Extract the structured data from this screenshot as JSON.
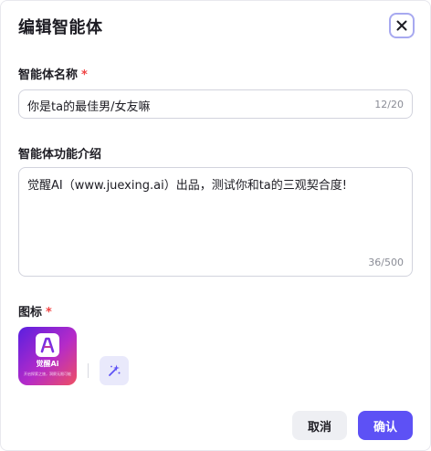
{
  "dialog": {
    "title": "编辑智能体",
    "close_icon": "close-icon"
  },
  "name_field": {
    "label": "智能体名称",
    "required_mark": "*",
    "value": "你是ta的最佳男/女友嘛",
    "counter": "12/20"
  },
  "description_field": {
    "label": "智能体功能介绍",
    "value": "觉醒AI（www.juexing.ai）出品，测试你和ta的三观契合度!",
    "counter": "36/500"
  },
  "icon_field": {
    "label": "图标",
    "required_mark": "*",
    "logo_text": "觉醒Ai",
    "logo_tagline": "开启探索之旅，洞察无限可能",
    "generate_icon": "sparkle-icon"
  },
  "footer": {
    "cancel_label": "取消",
    "confirm_label": "确认"
  },
  "colors": {
    "accent": "#5d51f5",
    "required": "#f04343",
    "close_border": "#a7a9f0"
  }
}
